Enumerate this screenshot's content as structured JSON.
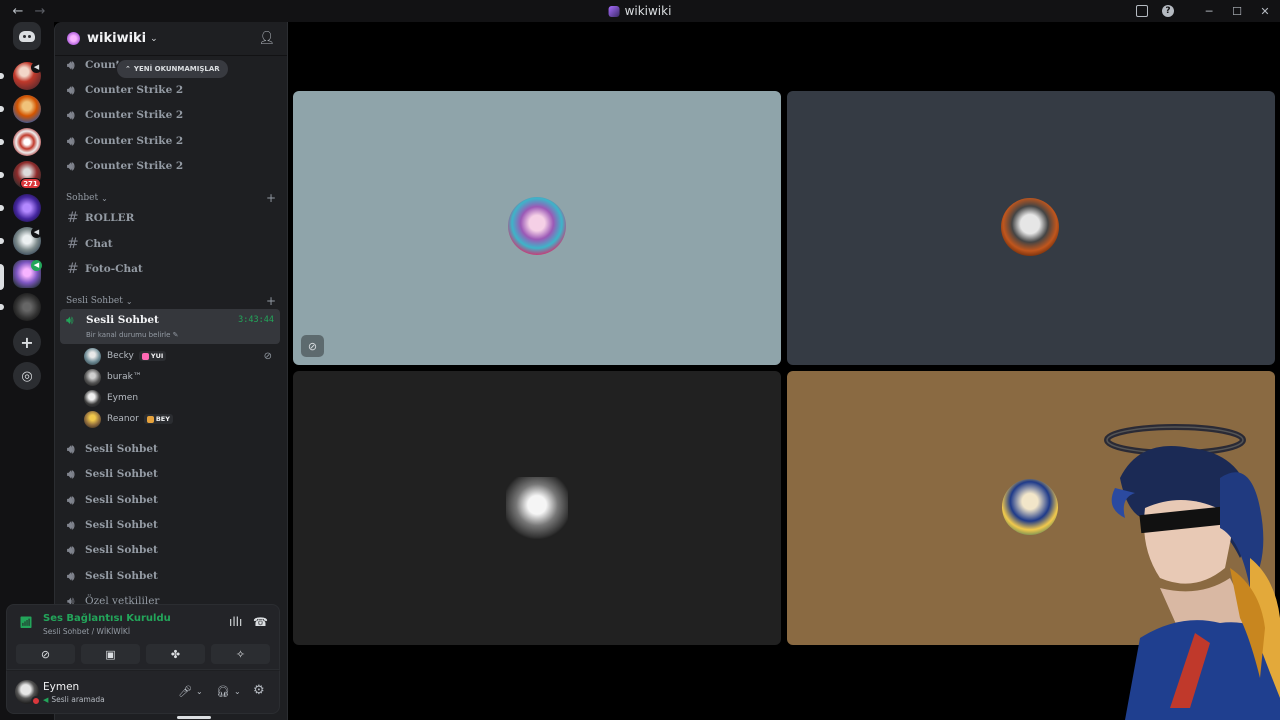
{
  "titlebar": {
    "back_icon": "←",
    "forward_icon": "→",
    "title": "wikiwiki",
    "inbox_icon": "inbox-icon",
    "help_icon": "?",
    "minimize": "─",
    "maximize": "☐",
    "close": "✕"
  },
  "rail": {
    "servers": [
      {
        "name": "server-1",
        "speaker": true
      },
      {
        "name": "server-2"
      },
      {
        "name": "server-3"
      },
      {
        "name": "server-4",
        "badge": "271"
      },
      {
        "name": "server-5"
      },
      {
        "name": "server-6",
        "speaker": true
      },
      {
        "name": "wikiwiki",
        "active": true
      },
      {
        "name": "server-8"
      }
    ],
    "add_server": "+",
    "explore": "◎"
  },
  "server": {
    "name": "wikiwiki",
    "chevron": "⌄",
    "invite_icon": "add-friend-icon"
  },
  "unread_pill": "YENİ OKUNMAMIŞLAR",
  "channels_top": [
    {
      "name": "Counter Strike 2",
      "type": "voice"
    },
    {
      "name": "Counter Strike 2",
      "type": "voice"
    },
    {
      "name": "Counter Strike 2",
      "type": "voice"
    },
    {
      "name": "Counter Strike 2",
      "type": "voice"
    },
    {
      "name": "Counter Strike 2",
      "type": "voice"
    }
  ],
  "categories": {
    "sohbet": "Sohbet",
    "sesli_sohbet": "Sesli Sohbet"
  },
  "text_channels": [
    {
      "name": "ROLLER"
    },
    {
      "name": "Chat"
    },
    {
      "name": "Foto-Chat"
    }
  ],
  "active_channel": {
    "name": "Sesli Sohbet",
    "timer": "3:43:44",
    "status_hint": "Bir kanal durumu belirle"
  },
  "voice_users": [
    {
      "name": "Becky",
      "tag": "YUI",
      "muted": true
    },
    {
      "name": "burak™"
    },
    {
      "name": "Eymen"
    },
    {
      "name": "Reanor",
      "tag": "BEY"
    }
  ],
  "voice_channels": [
    {
      "name": "Sesli Sohbet"
    },
    {
      "name": "Sesli Sohbet"
    },
    {
      "name": "Sesli Sohbet"
    },
    {
      "name": "Sesli Sohbet"
    },
    {
      "name": "Sesli Sohbet"
    },
    {
      "name": "Sesli Sohbet"
    },
    {
      "name": "Özel yetkililer"
    }
  ],
  "voice_panel": {
    "title": "Ses Bağlantısı Kuruldu",
    "subtitle": "Sesli Sohbet / WİKİWİKİ",
    "buttons": [
      "camera-off-icon",
      "screen-share-icon",
      "activities-icon",
      "soundboard-icon"
    ]
  },
  "user_panel": {
    "name": "Eymen",
    "status": "Sesli aramada"
  },
  "tiles": [
    {
      "name": "tile-becky",
      "color": "#8fa4aa",
      "cam_off_icon": "camera-off-icon"
    },
    {
      "name": "tile-burak",
      "color": "#353b44"
    },
    {
      "name": "tile-eymen",
      "color": "#212121"
    },
    {
      "name": "tile-reanor",
      "color": "#8a6a42"
    }
  ],
  "colors": {
    "green": "#23a55a",
    "red": "#da373c",
    "sidebar": "#1e1f22",
    "rail": "#121214"
  }
}
